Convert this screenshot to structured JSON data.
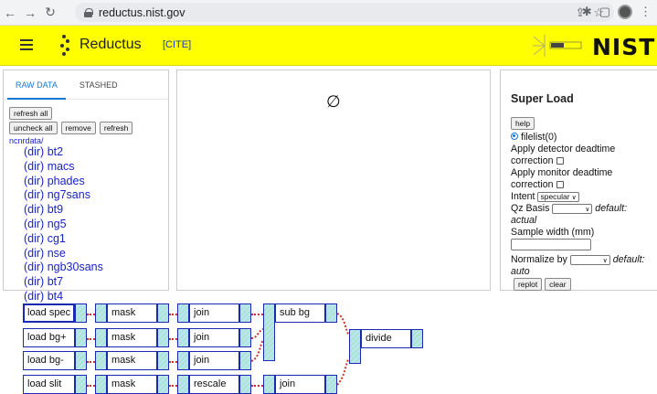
{
  "browser": {
    "url": "reductus.nist.gov"
  },
  "header": {
    "app_title": "Reductus",
    "cite": "[CITE]",
    "org": "NIST"
  },
  "left_panel": {
    "tabs": [
      {
        "label": "RAW DATA",
        "active": true
      },
      {
        "label": "STASHED",
        "active": false
      }
    ],
    "buttons": [
      "refresh all",
      "uncheck all",
      "remove",
      "refresh"
    ],
    "path": "ncnrdata/",
    "files": [
      "(dir) bt2",
      "(dir) macs",
      "(dir) phades",
      "(dir) ng7sans",
      "(dir) bt9",
      "(dir) ng5",
      "(dir) cg1",
      "(dir) nse",
      "(dir) ngb30sans",
      "(dir) bt7",
      "(dir) bt4"
    ]
  },
  "center_panel": {
    "placeholder": "∅"
  },
  "right_panel": {
    "title": "Super Load",
    "help": "help",
    "filelist": "filelist(0)",
    "detector_deadtime": "Apply detector deadtime correction",
    "monitor_deadtime": "Apply monitor deadtime correction",
    "intent_label": "Intent",
    "intent_value": "specular",
    "qz_label": "Qz Basis",
    "qz_default": "default:",
    "qz_default_value": "actual",
    "sample_width_label": "Sample width (mm)",
    "normalize_label": "Normalize by",
    "normalize_default": "default:",
    "normalize_default_value": "auto",
    "replot": "replot",
    "clear": "clear"
  },
  "flow": {
    "nodes": [
      {
        "label": "load spec",
        "selected": true
      },
      {
        "label": "mask"
      },
      {
        "label": "join"
      },
      {
        "label": "sub bg"
      },
      {
        "label": "load bg+"
      },
      {
        "label": "mask"
      },
      {
        "label": "join"
      },
      {
        "label": "divide"
      },
      {
        "label": "load bg-"
      },
      {
        "label": "mask"
      },
      {
        "label": "join"
      },
      {
        "label": "load slit"
      },
      {
        "label": "mask"
      },
      {
        "label": "rescale"
      },
      {
        "label": "join"
      }
    ]
  },
  "colors": {
    "header_bg": "#ffff00",
    "link": "#1a22cc",
    "tab_active": "#1976d2",
    "node_border": "#1a2ab0",
    "wire": "#c6312b"
  },
  "icons": [
    "back-icon",
    "forward-icon",
    "reload-icon",
    "lock-icon",
    "share-icon",
    "star-icon",
    "extensions-icon",
    "sidepanel-icon",
    "profile-icon",
    "menu-icon",
    "hamburger-icon",
    "nist-seal-icon"
  ]
}
